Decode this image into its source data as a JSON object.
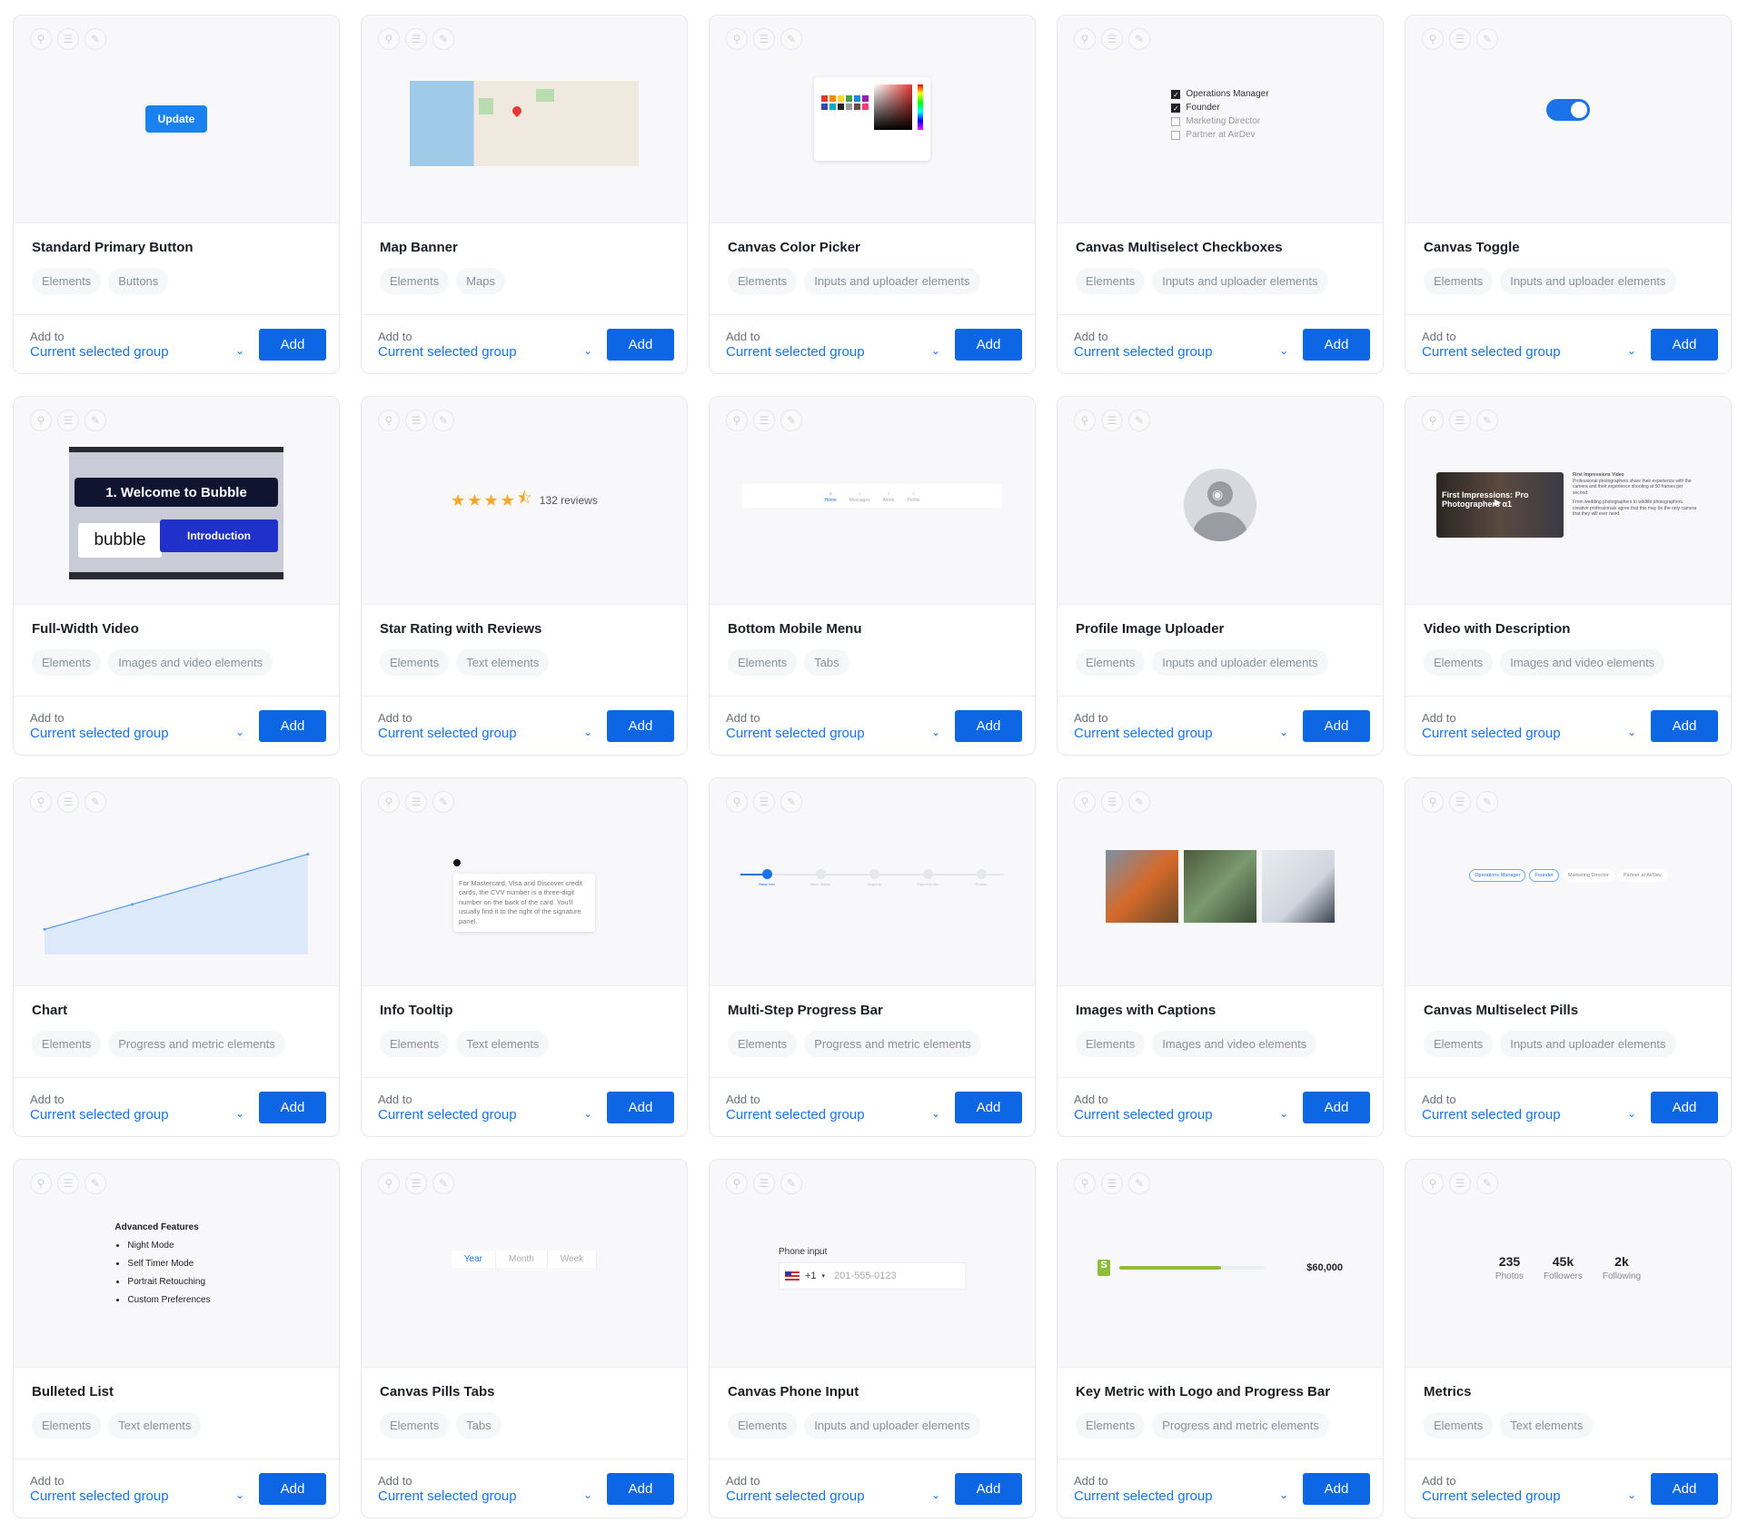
{
  "footer": {
    "add_to_label": "Add to",
    "group_label": "Current selected group",
    "add_button": "Add"
  },
  "preview_icons": [
    "hierarchy-icon",
    "database-icon",
    "pin-icon"
  ],
  "colors": {
    "accent": "#0d66e4",
    "link": "#1a73e8",
    "metric_bar": "#8dbd3a"
  },
  "cards": [
    {
      "title": "Standard Primary Button",
      "tags": [
        "Elements",
        "Buttons"
      ],
      "preview": {
        "type": "button",
        "label": "Update"
      }
    },
    {
      "title": "Map Banner",
      "tags": [
        "Elements",
        "Maps"
      ],
      "preview": {
        "type": "map"
      }
    },
    {
      "title": "Canvas Color Picker",
      "tags": [
        "Elements",
        "Inputs and uploader elements"
      ],
      "preview": {
        "type": "color"
      }
    },
    {
      "title": "Canvas Multiselect Checkboxes",
      "tags": [
        "Elements",
        "Inputs and uploader elements"
      ],
      "preview": {
        "type": "checkboxes",
        "options": [
          {
            "label": "Operations Manager",
            "checked": true
          },
          {
            "label": "Founder",
            "checked": true
          },
          {
            "label": "Marketing Director",
            "checked": false
          },
          {
            "label": "Partner at AirDev",
            "checked": false
          }
        ]
      }
    },
    {
      "title": "Canvas Toggle",
      "tags": [
        "Elements",
        "Inputs and uploader elements"
      ],
      "preview": {
        "type": "toggle",
        "on": true
      }
    },
    {
      "title": "Full-Width Video",
      "tags": [
        "Elements",
        "Images and video elements"
      ],
      "preview": {
        "type": "video",
        "heading": "1. Welcome to Bubble",
        "logo": "bubble",
        "sub": "Introduction"
      }
    },
    {
      "title": "Star Rating with Reviews",
      "tags": [
        "Elements",
        "Text elements"
      ],
      "preview": {
        "type": "stars",
        "rating": 4.5,
        "reviews": "132 reviews"
      }
    },
    {
      "title": "Bottom Mobile Menu",
      "tags": [
        "Elements",
        "Tabs"
      ],
      "preview": {
        "type": "mobilemenu",
        "items": [
          "Home",
          "Messages",
          "Alerts",
          "Profile"
        ],
        "active": 0
      }
    },
    {
      "title": "Profile Image Uploader",
      "tags": [
        "Elements",
        "Inputs and uploader elements"
      ],
      "preview": {
        "type": "avatar"
      }
    },
    {
      "title": "Video with Description",
      "tags": [
        "Elements",
        "Images and video elements"
      ],
      "preview": {
        "type": "videodesc",
        "video_title": "First Impressions: Pro Photographers α1",
        "heading": "First Impressions Video",
        "p1": "Professional photographers share their experience with the camera and their experience shooting at 50 frames per second.",
        "p2": "From wedding photographers to wildlife photographers, creative professionals agree that this may be the only camera that they will ever need."
      }
    },
    {
      "title": "Chart",
      "tags": [
        "Elements",
        "Progress and metric elements"
      ],
      "preview": {
        "type": "chart",
        "values": [
          1,
          2,
          3,
          4
        ]
      }
    },
    {
      "title": "Info Tooltip",
      "tags": [
        "Elements",
        "Text elements"
      ],
      "preview": {
        "type": "tooltip",
        "text": "For Mastercard, Visa and Discover credit cards, the CVV number is a three-digit number on the back of the card. You'll usually find it to the right of the signature panel."
      }
    },
    {
      "title": "Multi-Step Progress Bar",
      "tags": [
        "Elements",
        "Progress and metric elements"
      ],
      "preview": {
        "type": "steps",
        "steps": [
          "Basic Info",
          "More details",
          "Shipping",
          "Payment info",
          "Review"
        ],
        "current": 1
      }
    },
    {
      "title": "Images with Captions",
      "tags": [
        "Elements",
        "Images and video elements"
      ],
      "preview": {
        "type": "images"
      }
    },
    {
      "title": "Canvas Multiselect Pills",
      "tags": [
        "Elements",
        "Inputs and uploader elements"
      ],
      "preview": {
        "type": "pills",
        "options": [
          {
            "label": "Operations Manager",
            "selected": true
          },
          {
            "label": "Founder",
            "selected": true
          },
          {
            "label": "Marketing Director",
            "selected": false
          },
          {
            "label": "Partner at AirDev",
            "selected": false
          }
        ]
      }
    },
    {
      "title": "Bulleted List",
      "tags": [
        "Elements",
        "Text elements"
      ],
      "preview": {
        "type": "list",
        "heading": "Advanced Features",
        "items": [
          "Night Mode",
          "Self Timer Mode",
          "Portrait Retouching",
          "Custom Preferences"
        ]
      }
    },
    {
      "title": "Canvas Pills Tabs",
      "tags": [
        "Elements",
        "Tabs"
      ],
      "preview": {
        "type": "pilltabs",
        "tabs": [
          "Year",
          "Month",
          "Week"
        ],
        "active": 0
      }
    },
    {
      "title": "Canvas Phone Input",
      "tags": [
        "Elements",
        "Inputs and uploader elements"
      ],
      "preview": {
        "type": "phone",
        "label": "Phone input",
        "code": "+1",
        "placeholder": "201-555-0123"
      }
    },
    {
      "title": "Key Metric with Logo and Progress Bar",
      "tags": [
        "Elements",
        "Progress and metric elements"
      ],
      "preview": {
        "type": "keymetric",
        "progress": 0.7,
        "value": "$60,000"
      }
    },
    {
      "title": "Metrics",
      "tags": [
        "Elements",
        "Text elements"
      ],
      "preview": {
        "type": "metrics",
        "items": [
          {
            "value": "235",
            "label": "Photos"
          },
          {
            "value": "45k",
            "label": "Followers"
          },
          {
            "value": "2k",
            "label": "Following"
          }
        ]
      }
    }
  ]
}
